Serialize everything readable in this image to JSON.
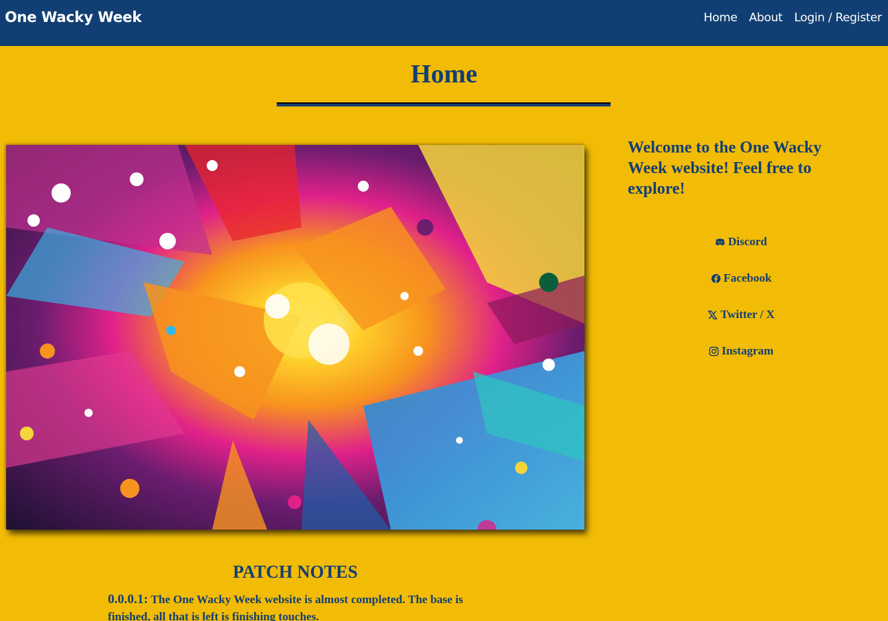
{
  "navbar": {
    "brand": "One Wacky Week",
    "links": [
      {
        "label": "Home"
      },
      {
        "label": "About"
      },
      {
        "label": "Login / Register"
      }
    ]
  },
  "page": {
    "title": "Home"
  },
  "hero": {
    "image_alt": "colorful paint splatter artwork"
  },
  "sidebar": {
    "welcome": "Welcome to the One Wacky Week website! Feel free to explore!",
    "social_links": [
      {
        "label": "Discord",
        "icon": "discord-icon"
      },
      {
        "label": "Facebook",
        "icon": "facebook-icon"
      },
      {
        "label": "Twitter / X",
        "icon": "x-twitter-icon"
      },
      {
        "label": "Instagram",
        "icon": "instagram-icon"
      }
    ]
  },
  "patch_notes": {
    "title": "PATCH NOTES",
    "entries": [
      {
        "version": "0.0.0.1:",
        "text": "The One Wacky Week website is almost completed. The base is finished, all that is left is finishing touches."
      }
    ]
  },
  "colors": {
    "navbar": "#123f73",
    "background": "#f2bb05",
    "text": "#123f73"
  }
}
